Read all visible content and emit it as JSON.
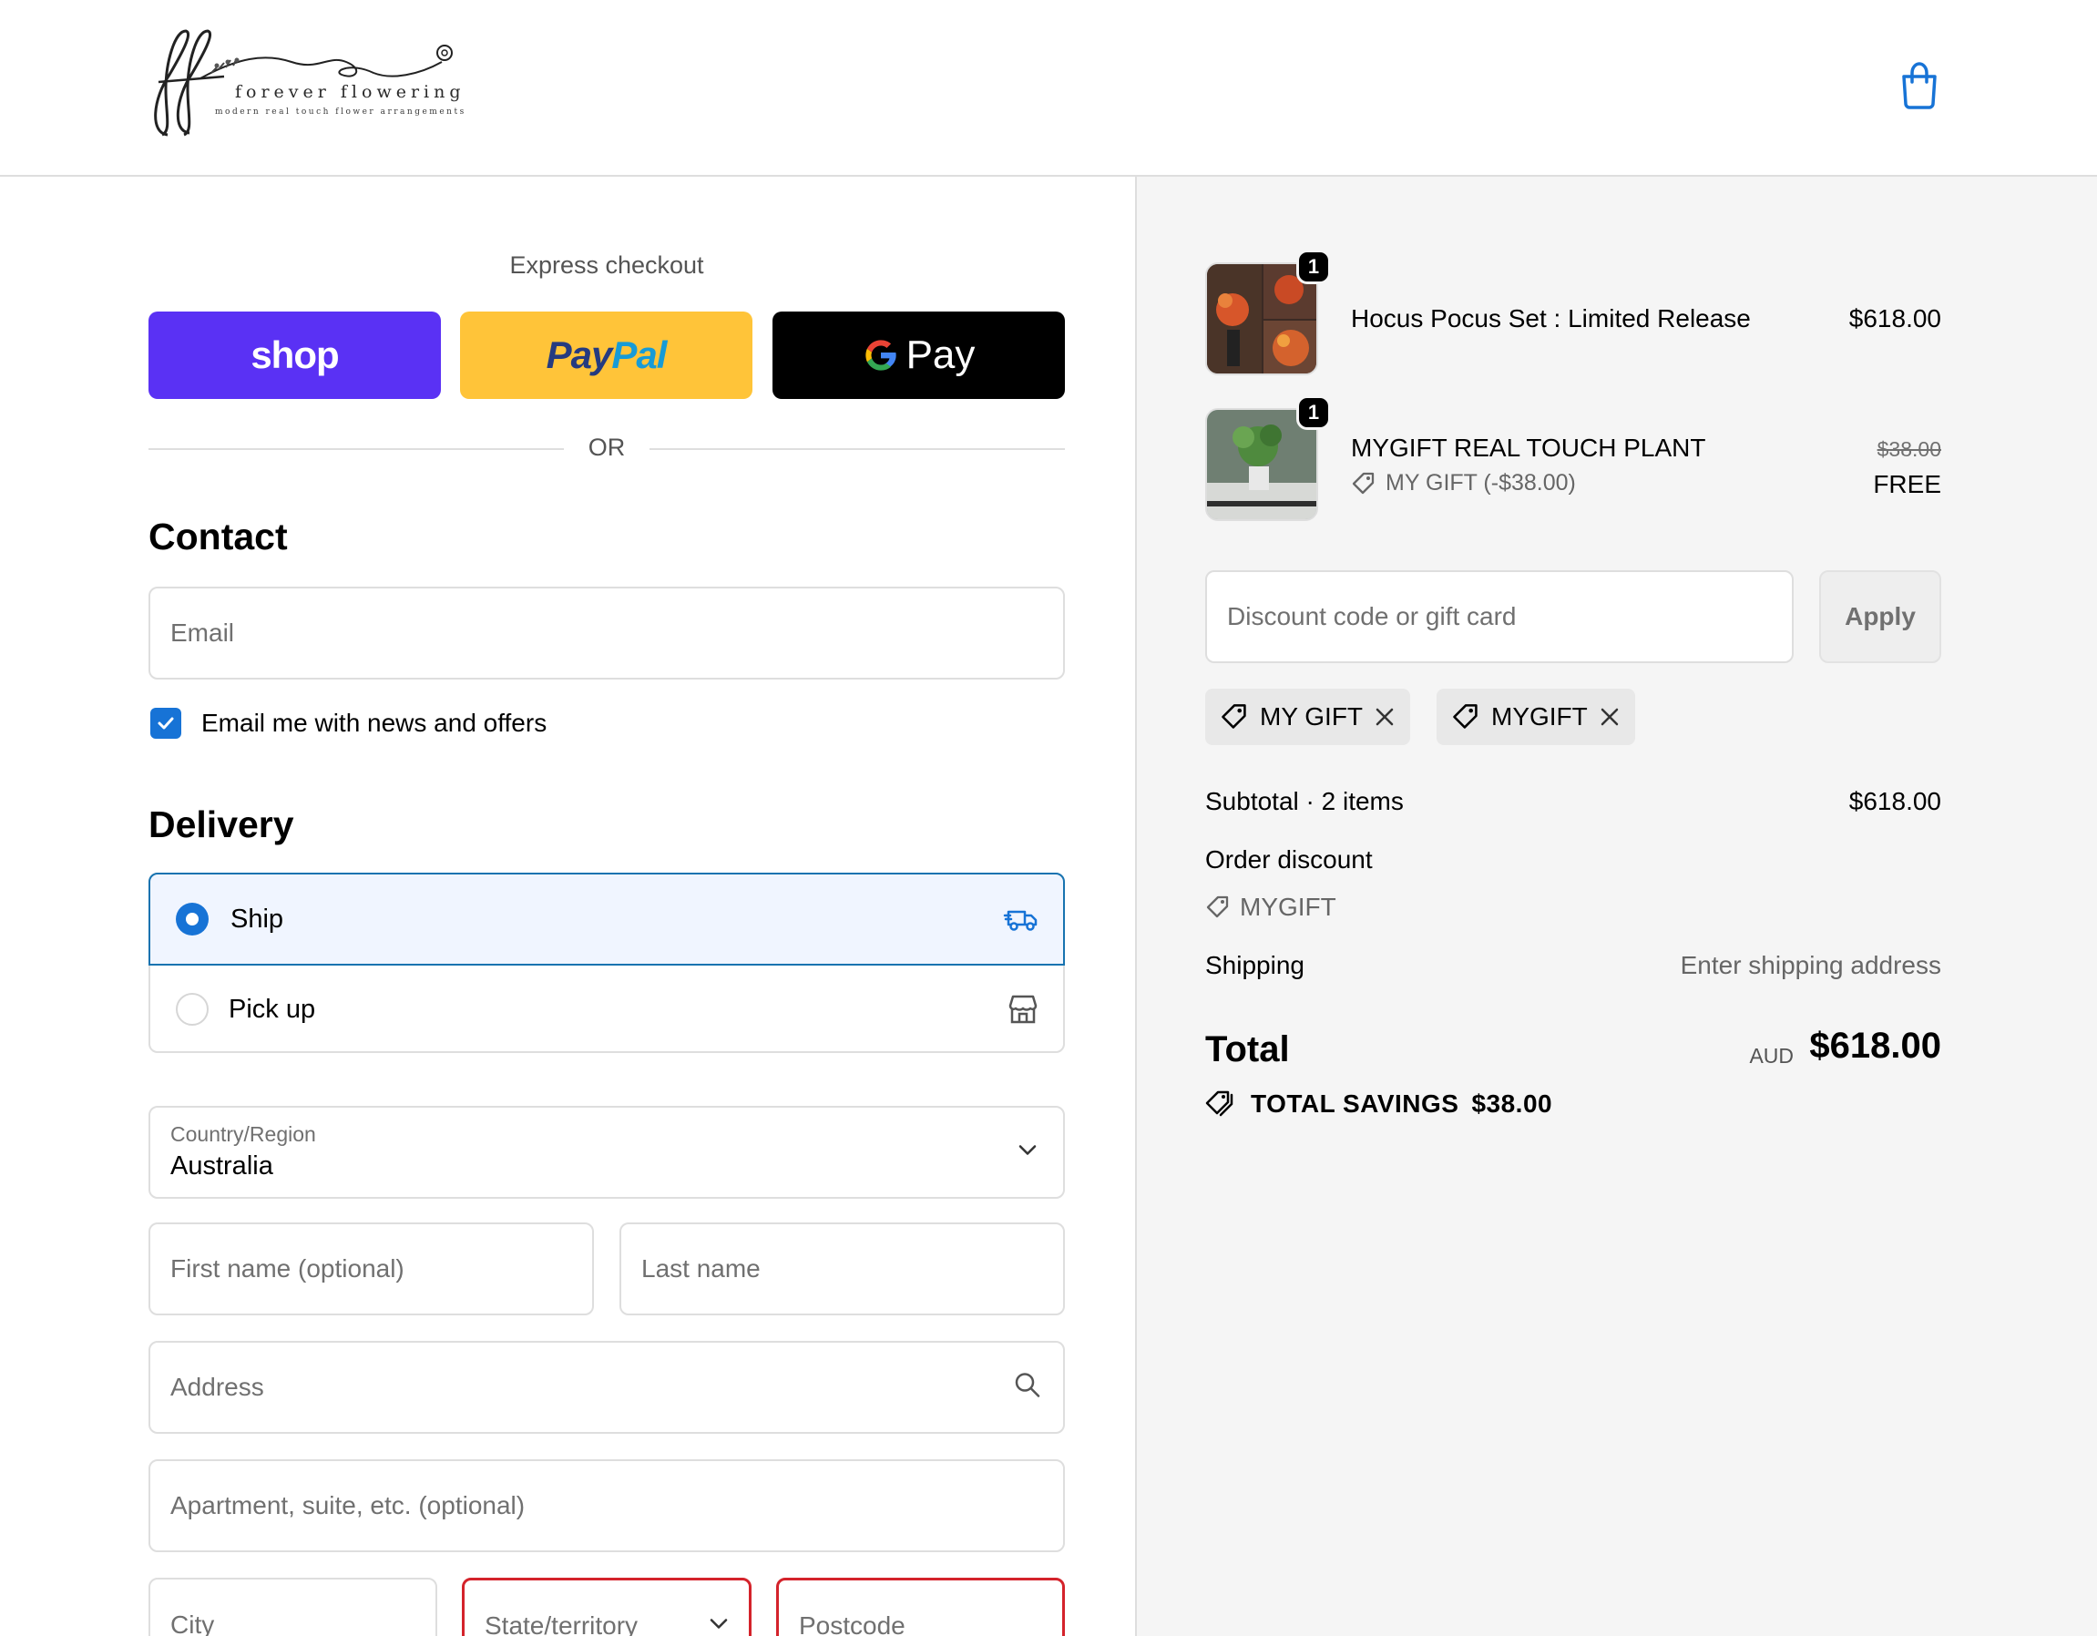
{
  "brand": {
    "name": "forever flowering",
    "tagline": "modern real touch flower arrangements"
  },
  "express": {
    "title": "Express checkout",
    "shop_label": "shop",
    "paypal_a": "Pay",
    "paypal_b": "Pal",
    "gpay_label": "Pay",
    "or_label": "OR"
  },
  "contact": {
    "title": "Contact",
    "email_placeholder": "Email",
    "newsletter_label": "Email me with news and offers",
    "newsletter_checked": true
  },
  "delivery": {
    "title": "Delivery",
    "options": [
      {
        "label": "Ship",
        "selected": true,
        "icon": "truck-icon"
      },
      {
        "label": "Pick up",
        "selected": false,
        "icon": "store-icon"
      }
    ],
    "country_label": "Country/Region",
    "country_value": "Australia",
    "first_name_placeholder": "First name (optional)",
    "last_name_placeholder": "Last name",
    "address_placeholder": "Address",
    "apartment_placeholder": "Apartment, suite, etc. (optional)",
    "city_placeholder": "City",
    "state_placeholder": "State/territory",
    "postcode_placeholder": "Postcode"
  },
  "summary": {
    "items": [
      {
        "name": "Hocus Pocus Set : Limited Release",
        "quantity": "1",
        "price": "$618.00"
      },
      {
        "name": "MYGIFT REAL TOUCH PLANT",
        "quantity": "1",
        "original_price": "$38.00",
        "price": "FREE",
        "discount_label": "MY GIFT (-$38.00)"
      }
    ],
    "discount_placeholder": "Discount code or gift card",
    "apply_label": "Apply",
    "applied_codes": [
      "MY GIFT",
      "MYGIFT"
    ],
    "subtotal_label": "Subtotal · 2 items",
    "subtotal_value": "$618.00",
    "order_discount_label": "Order discount",
    "order_discount_code": "MYGIFT",
    "shipping_label": "Shipping",
    "shipping_value": "Enter shipping address",
    "total_label": "Total",
    "currency": "AUD",
    "total_value": "$618.00",
    "savings_label": "TOTAL SAVINGS",
    "savings_value": "$38.00"
  },
  "colors": {
    "accent": "#1773d6",
    "shop": "#5a31f4",
    "paypal": "#ffc439",
    "gpay": "#000000",
    "error": "#d4232b"
  }
}
